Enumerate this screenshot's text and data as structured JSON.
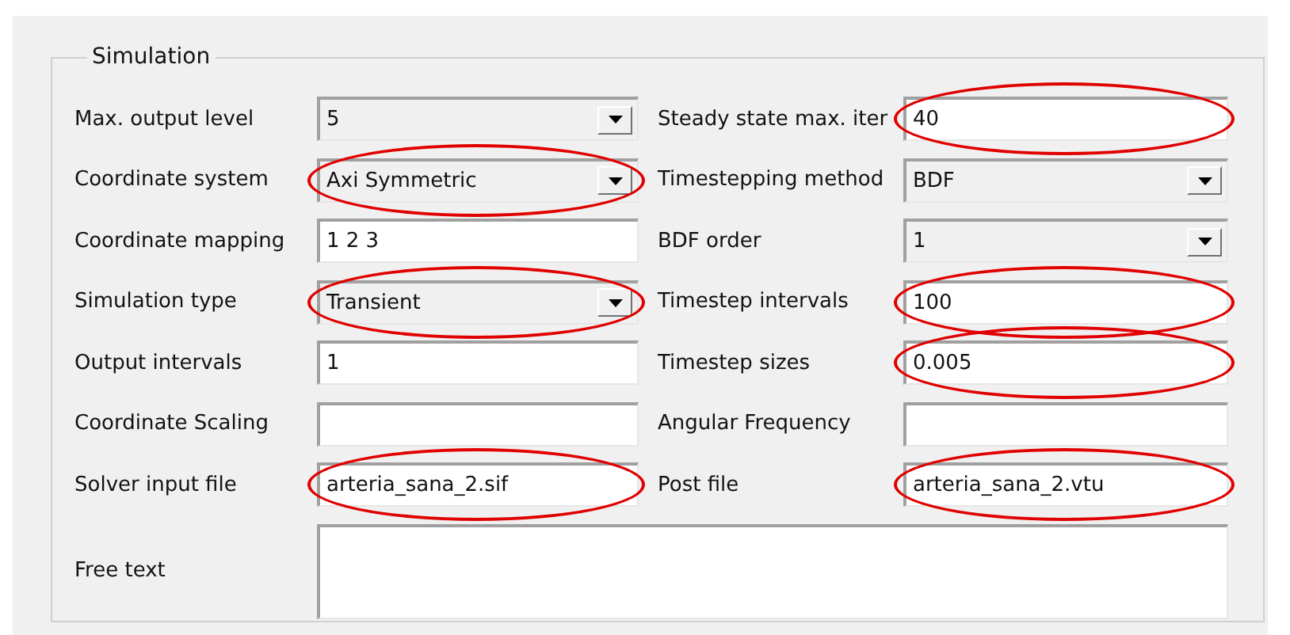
{
  "group": {
    "title": "Simulation"
  },
  "rows": [
    {
      "cells": [
        {
          "label": "Max. output level",
          "kind": "combo",
          "value": "5",
          "highlighted": false
        },
        {
          "label": "Steady state max. iter",
          "kind": "text",
          "value": "40",
          "highlighted": true
        }
      ]
    },
    {
      "cells": [
        {
          "label": "Coordinate system",
          "kind": "combo",
          "value": "Axi Symmetric",
          "highlighted": true
        },
        {
          "label": "Timestepping method",
          "kind": "combo",
          "value": "BDF",
          "highlighted": false
        }
      ]
    },
    {
      "cells": [
        {
          "label": "Coordinate mapping",
          "kind": "text",
          "value": "1 2 3",
          "highlighted": false
        },
        {
          "label": "BDF order",
          "kind": "combo",
          "value": "1",
          "highlighted": false
        }
      ]
    },
    {
      "cells": [
        {
          "label": "Simulation type",
          "kind": "combo",
          "value": "Transient",
          "highlighted": true
        },
        {
          "label": "Timestep intervals",
          "kind": "text",
          "value": "100",
          "highlighted": true
        }
      ]
    },
    {
      "cells": [
        {
          "label": "Output intervals",
          "kind": "text",
          "value": "1",
          "highlighted": false
        },
        {
          "label": "Timestep sizes",
          "kind": "text",
          "value": "0.005",
          "highlighted": true
        }
      ]
    },
    {
      "cells": [
        {
          "label": "Coordinate Scaling",
          "kind": "text",
          "highlighted": false
        },
        {
          "label": "Angular Frequency",
          "kind": "text",
          "highlighted": false
        }
      ]
    },
    {
      "cells": [
        {
          "label": "Solver input file",
          "kind": "text",
          "value": "arteria_sana_2.sif",
          "highlighted": true
        },
        {
          "label": "Post file",
          "kind": "text",
          "value": "arteria_sana_2.vtu",
          "highlighted": true
        }
      ]
    }
  ],
  "free_text": {
    "label": "Free text",
    "kind": "textarea",
    "highlighted": false
  }
}
